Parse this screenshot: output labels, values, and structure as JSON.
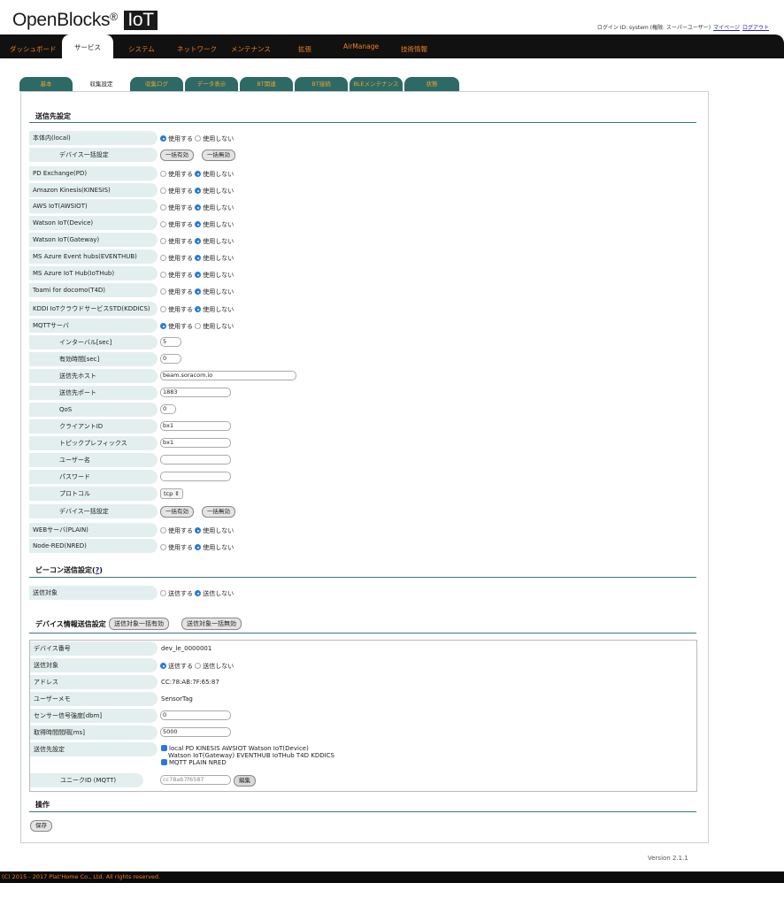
{
  "header": {
    "logo_text": "OpenBlocks",
    "logo_reg": "®",
    "logo_iot": "IoT",
    "login_info": "ログイン ID: system (権限: スーパーユーザー)",
    "mypage_link": "マイページ",
    "logout_link": "ログアウト"
  },
  "nav": {
    "items": [
      "ダッシュボード",
      "サービス",
      "システム",
      "ネットワーク",
      "メンテナンス",
      "拡張",
      "AirManage",
      "技術情報"
    ],
    "active": "サービス"
  },
  "tabs": {
    "items": [
      "基本",
      "収集設定",
      "収集ログ",
      "データ表示",
      "BT関連",
      "BT接続",
      "BLEメンテナンス",
      "状態"
    ],
    "active": "収集設定"
  },
  "destinations": {
    "title": "送信先設定",
    "use_label": "使用する",
    "nouse_label": "使用しない",
    "bulk_enable": "一括有効",
    "bulk_disable": "一括無効",
    "rows": [
      {
        "label": "本体内(local)",
        "selected": "use"
      },
      {
        "label": "デバイス一括設定",
        "type": "bulk"
      },
      {
        "label": "PD Exchange(PD)",
        "selected": "nouse"
      },
      {
        "label": "Amazon Kinesis(KINESIS)",
        "selected": "nouse"
      },
      {
        "label": "AWS IoT(AWSIOT)",
        "selected": "nouse"
      },
      {
        "label": "Watson IoT(Device)",
        "selected": "nouse"
      },
      {
        "label": "Watson IoT(Gateway)",
        "selected": "nouse"
      },
      {
        "label": "MS Azure Event hubs(EVENTHUB)",
        "selected": "nouse"
      },
      {
        "label": "MS Azure IoT Hub(IoTHub)",
        "selected": "nouse"
      },
      {
        "label": "Toami for docomo(T4D)",
        "selected": "nouse"
      },
      {
        "label": "KDDI IoTクラウドサービスSTD(KDDICS)",
        "selected": "nouse"
      },
      {
        "label": "MQTTサーバ",
        "selected": "use"
      }
    ],
    "mqtt": {
      "interval_label": "インターバル[sec]",
      "interval_value": "5",
      "expire_label": "有効時間[sec]",
      "expire_value": "0",
      "host_label": "送信先ホスト",
      "host_value": "beam.soracom.io",
      "port_label": "送信先ポート",
      "port_value": "1883",
      "qos_label": "QoS",
      "qos_value": "0",
      "client_label": "クライアントID",
      "client_value": "bx1",
      "topic_label": "トピックプレフィックス",
      "topic_value": "bx1",
      "user_label": "ユーザー名",
      "user_value": "",
      "pass_label": "パスワード",
      "pass_value": "",
      "protocol_label": "プロトコル",
      "protocol_value": "tcp",
      "bulk_label": "デバイス一括設定"
    },
    "web_label": "WEBサーバ(PLAIN)",
    "nred_label": "Node-RED(NRED)"
  },
  "beacon": {
    "title": "ビーコン送信設定(",
    "help": "?",
    "title_end": ")",
    "target_label": "送信対象",
    "send_label": "送信する",
    "nosend_label": "送信しない"
  },
  "device": {
    "title": "デバイス情報送信設定",
    "bulk_enable": "送信対象一括有効",
    "bulk_disable": "送信対象一括無効",
    "number_label": "デバイス番号",
    "number_value": "dev_le_0000001",
    "target_label": "送信対象",
    "address_label": "アドレス",
    "address_value": "CC:78:AB:7F:65:87",
    "memo_label": "ユーザーメモ",
    "memo_value": "SensorTag",
    "rssi_label": "センサー信号強度[dbm]",
    "rssi_value": "0",
    "interval_label": "取得時間間隔[ms]",
    "interval_value": "5000",
    "dest_label": "送信先設定",
    "dest_line1": "local   PD   KINESIS   AWSIOT   Watson IoT(Device)",
    "dest_line2": "Watson IoT(Gateway)   EVENTHUB   IoTHub   T4D   KDDICS",
    "dest_line3": "MQTT   PLAIN   NRED",
    "uid_label": "ユニークID (MQTT)",
    "uid_value": "cc78ab7f6587",
    "edit_button": "編集"
  },
  "ops": {
    "title": "操作",
    "save_button": "保存"
  },
  "version": "Version 2.1.1",
  "footer": "(C) 2015 - 2017 Plat'Home Co., Ltd. All rights reserved."
}
